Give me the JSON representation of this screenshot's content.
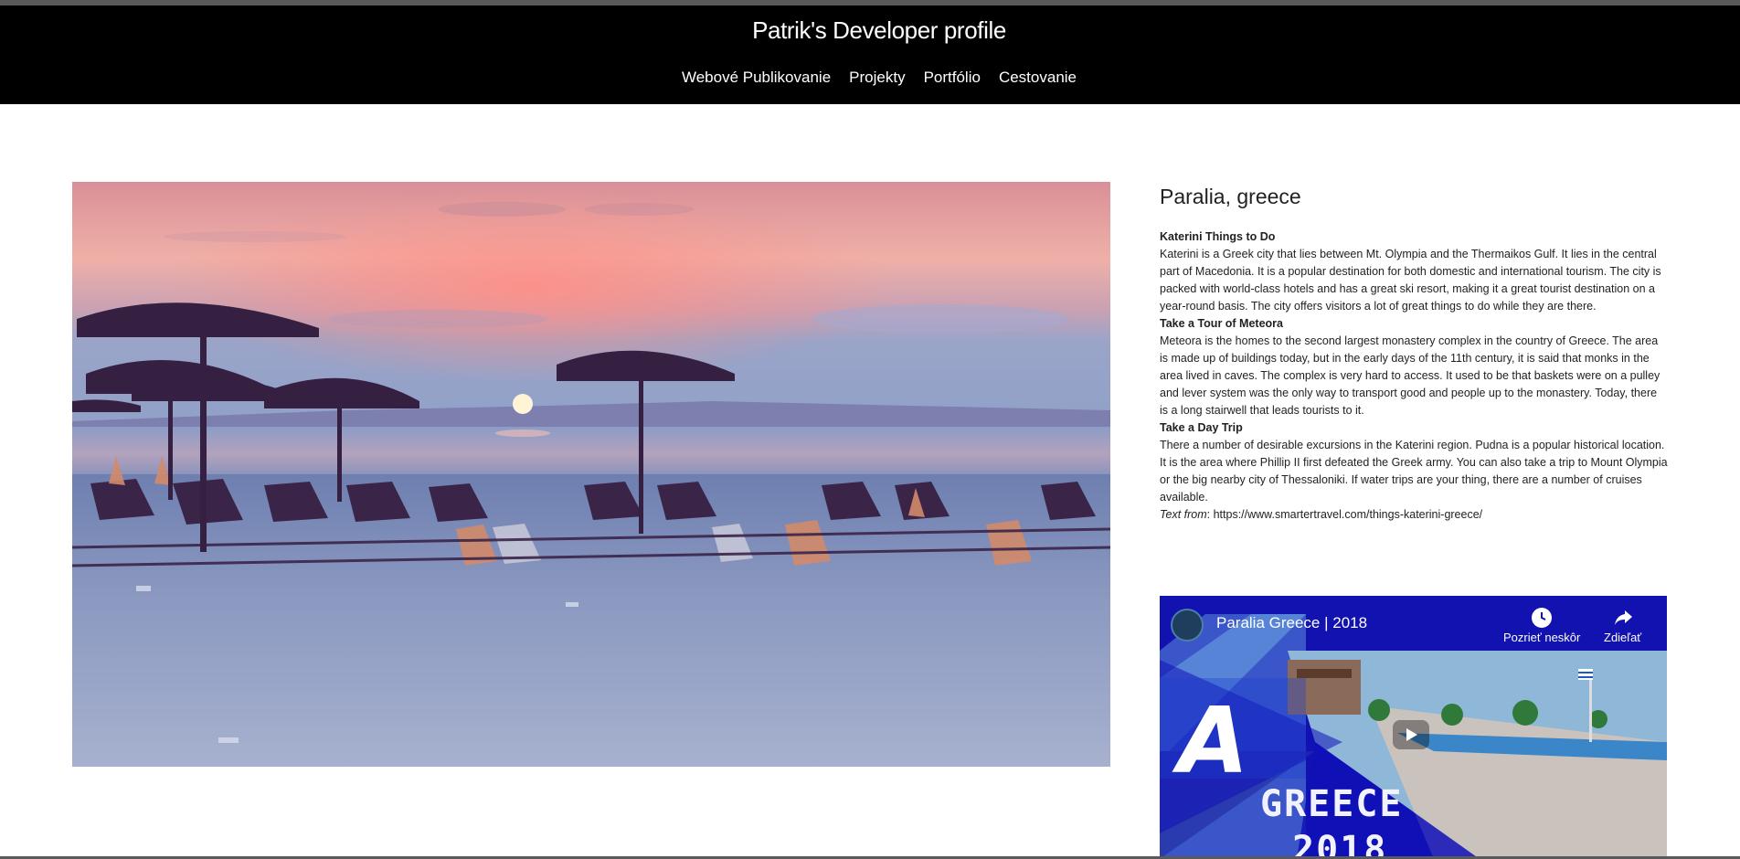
{
  "header": {
    "title": "Patrik's Developer profile",
    "nav": [
      {
        "label": "Webové Publikovanie"
      },
      {
        "label": "Projekty"
      },
      {
        "label": "Portfólio"
      },
      {
        "label": "Cestovanie"
      }
    ]
  },
  "main": {
    "destination_title": "Paralia, greece",
    "sections": [
      {
        "heading": "Katerini Things to Do",
        "text": "Katerini is a Greek city that lies between Mt. Olympia and the Thermaikos Gulf. It lies in the central part of Macedonia. It is a popular destination for both domestic and international tourism. The city is packed with world-class hotels and has a great ski resort, making it a great tourist destination on a year-round basis. The city offers visitors a lot of great things to do while they are there."
      },
      {
        "heading": "Take a Tour of Meteora",
        "text": "Meteora is the homes to the second largest monastery complex in the country of Greece. The area is made up of buildings today, but in the early days of the 11th century, it is said that monks in the area lived in caves. The complex is very hard to access. It used to be that baskets were on a pulley and lever system was the only way to transport good and people up to the monastery. Today, there is a long stairwell that leads tourists to it."
      },
      {
        "heading": "Take a Day Trip",
        "text": "There a number of desirable excursions in the Katerini region. Pudna is a popular historical location. It is the area where Phillip II first defeated the Greek army. You can also take a trip to Mount Olympia or the big nearby city of Thessaloniki. If water trips are your thing, there are a number of cruises available."
      }
    ],
    "source": {
      "label": "Text from",
      "separator": ": ",
      "url": "https://www.smartertravel.com/things-katerini-greece/"
    }
  },
  "video": {
    "title": "Paralia Greece | 2018",
    "watch_later": "Pozrieť neskôr",
    "share": "Zdieľať",
    "thumbnail_text_line1": "GREECE",
    "thumbnail_text_line2": "2018",
    "thumbnail_letter": "A"
  }
}
